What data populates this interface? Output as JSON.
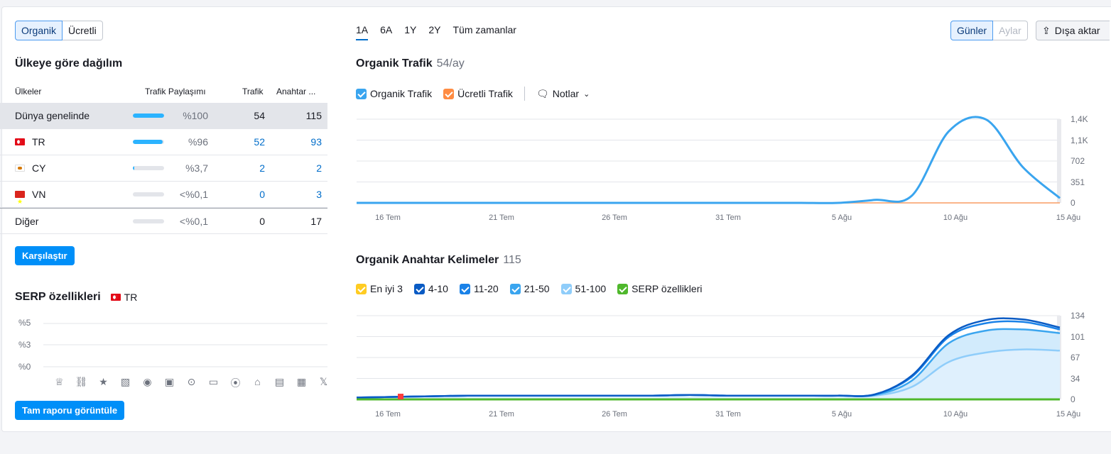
{
  "toggle": {
    "organic": "Organik",
    "paid": "Ücretli"
  },
  "country": {
    "title": "Ülkeye göre dağılım",
    "headers": {
      "country": "Ülkeler",
      "share": "Trafik Paylaşımı",
      "traffic": "Trafik",
      "keywords": "Anahtar ..."
    },
    "rows": [
      {
        "name": "Dünya genelinde",
        "flag": "",
        "share": "%100",
        "share_pct": 100,
        "traffic": "54",
        "keywords": "115"
      },
      {
        "name": "TR",
        "flag": "tr",
        "share": "%96",
        "share_pct": 96,
        "traffic": "52",
        "keywords": "93"
      },
      {
        "name": "CY",
        "flag": "cy",
        "share": "%3,7",
        "share_pct": 3.7,
        "traffic": "2",
        "keywords": "2"
      },
      {
        "name": "VN",
        "flag": "vn",
        "share": "<%0,1",
        "share_pct": 0,
        "traffic": "0",
        "keywords": "3"
      },
      {
        "name": "Diğer",
        "flag": "",
        "share": "<%0,1",
        "share_pct": 0,
        "traffic": "0",
        "keywords": "17"
      }
    ],
    "compare_button": "Karşılaştır"
  },
  "serp": {
    "title": "SERP özellikleri",
    "country": "TR",
    "yticks": [
      "%5",
      "%3",
      "%0"
    ],
    "icons": [
      "crown-icon",
      "link-icon",
      "star-icon",
      "image-icon",
      "video-icon",
      "video-box-icon",
      "play-icon",
      "chat-icon",
      "pin-icon",
      "graduation-icon",
      "news-icon",
      "briefcase-icon",
      "x-icon"
    ],
    "full_report_button": "Tam raporu görüntüle"
  },
  "range_tabs": [
    "1A",
    "6A",
    "1Y",
    "2Y",
    "Tüm zamanlar"
  ],
  "granularity": {
    "days": "Günler",
    "months": "Aylar"
  },
  "export_label": "Dışa aktar",
  "traffic_chart": {
    "title": "Organik Trafik",
    "subtitle": "54/ay",
    "legend": {
      "organic": "Organik Trafik",
      "paid": "Ücretli Trafik",
      "notes": "Notlar"
    },
    "colors": {
      "organic": "#3aa5ef",
      "paid": "#ff8c43"
    },
    "yticks": [
      "1,4K",
      "1,1K",
      "702",
      "351",
      "0"
    ]
  },
  "keywords_chart": {
    "title": "Organik Anahtar Kelimeler",
    "subtitle": "115",
    "legend": [
      {
        "label": "En iyi 3",
        "color": "#ffcc22"
      },
      {
        "label": "4-10",
        "color": "#0a5bc4"
      },
      {
        "label": "11-20",
        "color": "#1a82e8"
      },
      {
        "label": "21-50",
        "color": "#3aa5ef"
      },
      {
        "label": "51-100",
        "color": "#8fcdfa"
      },
      {
        "label": "SERP özellikleri",
        "color": "#4fb82c"
      }
    ],
    "yticks": [
      "134",
      "101",
      "67",
      "34",
      "0"
    ]
  },
  "xticks": [
    "16 Tem",
    "21 Tem",
    "26 Tem",
    "31 Tem",
    "5 Ağu",
    "10 Ağu",
    "15 Ağu"
  ],
  "chart_data": [
    {
      "type": "line",
      "title": "Organik Trafik",
      "x": [
        "14 Tem",
        "16 Tem",
        "18 Tem",
        "20 Tem",
        "22 Tem",
        "24 Tem",
        "26 Tem",
        "28 Tem",
        "30 Tem",
        "1 Ağu",
        "3 Ağu",
        "5 Ağu",
        "7 Ağu",
        "9 Ağu",
        "10 Ağu",
        "11 Ağu",
        "12 Ağu",
        "13 Ağu",
        "14 Ağu",
        "15 Ağu"
      ],
      "series": [
        {
          "name": "Organik Trafik",
          "values": [
            0,
            0,
            0,
            0,
            0,
            0,
            0,
            0,
            0,
            0,
            0,
            0,
            0,
            0,
            50,
            120,
            1200,
            1400,
            600,
            80
          ]
        },
        {
          "name": "Ücretli Trafik",
          "values": [
            0,
            0,
            0,
            0,
            0,
            0,
            0,
            0,
            0,
            0,
            0,
            0,
            0,
            0,
            0,
            0,
            0,
            0,
            0,
            0
          ]
        }
      ],
      "ylim": [
        0,
        1404
      ]
    },
    {
      "type": "area",
      "title": "Organik Anahtar Kelimeler",
      "x": [
        "14 Tem",
        "16 Tem",
        "18 Tem",
        "20 Tem",
        "22 Tem",
        "24 Tem",
        "26 Tem",
        "28 Tem",
        "30 Tem",
        "1 Ağu",
        "3 Ağu",
        "5 Ağu",
        "7 Ağu",
        "9 Ağu",
        "10 Ağu",
        "11 Ağu",
        "12 Ağu",
        "13 Ağu",
        "14 Ağu",
        "15 Ağu"
      ],
      "series": [
        {
          "name": "51-100",
          "values": [
            3,
            4,
            5,
            6,
            6,
            6,
            6,
            6,
            6,
            7,
            6,
            6,
            6,
            6,
            6,
            20,
            60,
            75,
            80,
            78
          ]
        },
        {
          "name": "21-50",
          "values": [
            3,
            4,
            5,
            6,
            6,
            6,
            6,
            6,
            6,
            7,
            6,
            6,
            6,
            6,
            7,
            30,
            90,
            110,
            112,
            106
          ]
        },
        {
          "name": "11-20",
          "values": [
            3,
            4,
            5,
            6,
            6,
            6,
            6,
            6,
            6,
            7,
            6,
            6,
            6,
            6,
            8,
            36,
            100,
            122,
            124,
            112
          ]
        },
        {
          "name": "4-10",
          "values": [
            3,
            4,
            5,
            6,
            6,
            6,
            6,
            6,
            6,
            7,
            6,
            6,
            6,
            6,
            8,
            38,
            103,
            127,
            128,
            115
          ]
        },
        {
          "name": "En iyi 3",
          "values": [
            0,
            0,
            0,
            0,
            0,
            0,
            0,
            0,
            0,
            0,
            0,
            0,
            0,
            0,
            0,
            0,
            0,
            0,
            0,
            0
          ]
        },
        {
          "name": "SERP özellikleri",
          "values": [
            0,
            0,
            0,
            0,
            0,
            0,
            0,
            0,
            0,
            0,
            0,
            0,
            0,
            0,
            0,
            0,
            0,
            0,
            0,
            0
          ]
        }
      ],
      "ylim": [
        0,
        134
      ]
    }
  ]
}
